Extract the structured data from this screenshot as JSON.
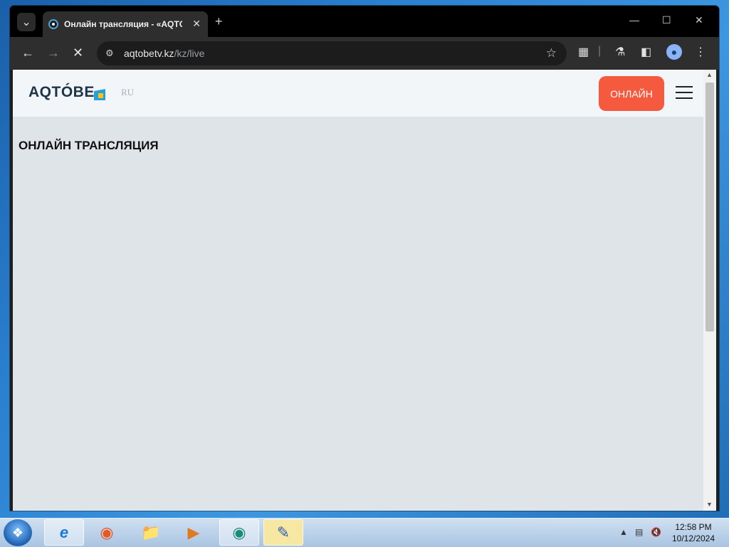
{
  "browser": {
    "tab_title": "Онлайн трансляция - «AQTÓBE",
    "tab_close": "✕",
    "new_tab": "+",
    "url_host": "aqtobetv.kz",
    "url_path": "/kz/live"
  },
  "site": {
    "logo_text": "AQTÓBE",
    "lang_label": "RU",
    "online_button": "ОНЛАЙН",
    "page_title": "ОНЛАЙН ТРАНСЛЯЦИЯ",
    "colors": {
      "accent": "#f65a3e",
      "logo": "#1e3447",
      "logo_mark_blue": "#2ba0d8",
      "logo_mark_yellow": "#f5c518"
    }
  },
  "taskbar": {
    "time": "12:58 PM",
    "date": "10/12/2024"
  }
}
